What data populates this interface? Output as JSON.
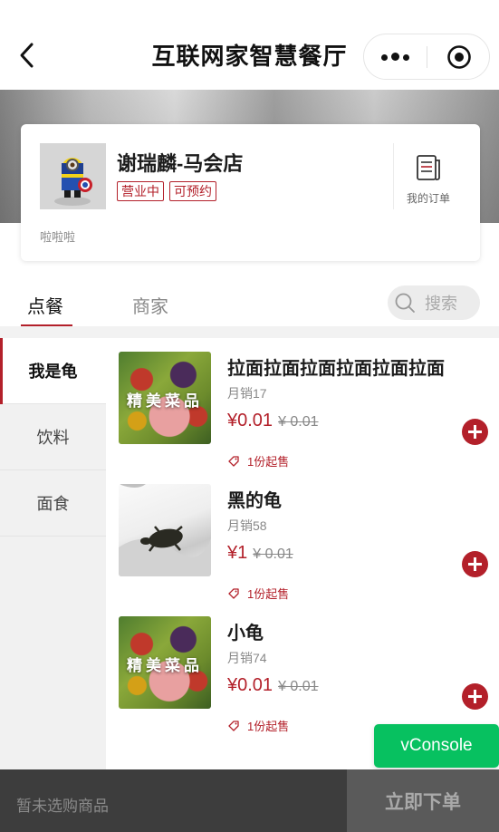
{
  "nav": {
    "title": "互联网家智慧餐厅",
    "back_icon": "chevron-left-icon",
    "more_icon": "more-dots-icon",
    "target_icon": "target-icon"
  },
  "shop": {
    "name": "谢瑞麟-马会店",
    "tags": [
      "营业中",
      "可预约"
    ],
    "description": "啦啦啦",
    "my_orders_label": "我的订单"
  },
  "tabs": {
    "order": "点餐",
    "merchant": "商家",
    "search_placeholder": "搜索"
  },
  "categories": [
    {
      "label": "我是龟",
      "active": true
    },
    {
      "label": "饮料",
      "active": false
    },
    {
      "label": "面食",
      "active": false
    }
  ],
  "products": [
    {
      "name": "拉面拉面拉面拉面拉面拉面",
      "image_text": "精美菜品",
      "sales": "月销17",
      "price": "¥0.01",
      "original_price": "¥ 0.01",
      "min_order": "1份起售"
    },
    {
      "name": "黑的龟",
      "image_text": "",
      "sales": "月销58",
      "price": "¥1",
      "original_price": "¥ 0.01",
      "min_order": "1份起售"
    },
    {
      "name": "小龟",
      "image_text": "精美菜品",
      "sales": "月销74",
      "price": "¥0.01",
      "original_price": "¥ 0.01",
      "min_order": "1份起售"
    }
  ],
  "vconsole_label": "vConsole",
  "bottom": {
    "cart_text": "暂未选购商品",
    "submit_label": "立即下单"
  },
  "colors": {
    "accent": "#b3202a",
    "vconsole": "#07c160",
    "bottom_bar": "#3d3d3d"
  }
}
